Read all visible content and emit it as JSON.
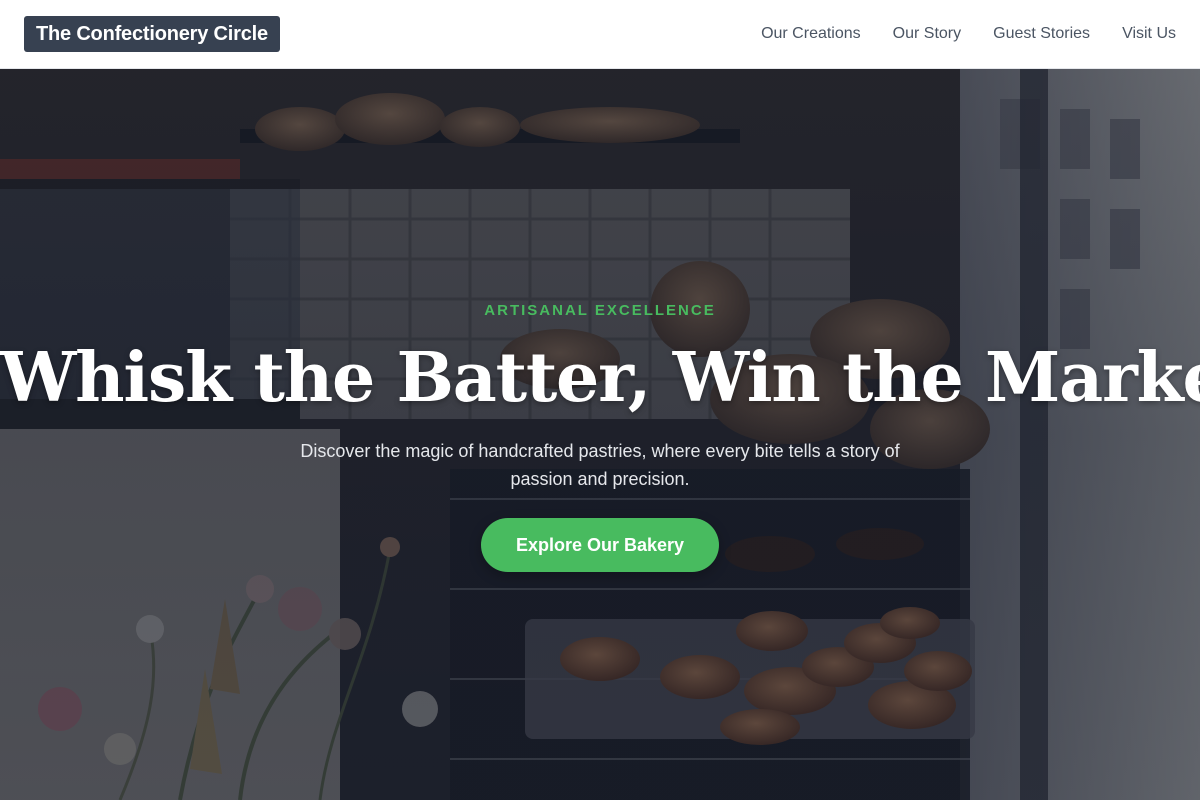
{
  "brand": {
    "name": "The Confectionery Circle"
  },
  "nav": {
    "items": [
      {
        "label": "Our Creations"
      },
      {
        "label": "Our Story"
      },
      {
        "label": "Guest Stories"
      },
      {
        "label": "Visit Us"
      }
    ]
  },
  "hero": {
    "eyebrow": "ARTISANAL EXCELLENCE",
    "headline": "Whisk the Batter, Win the Market.",
    "subheadline": "Discover the magic of handcrafted pastries, where every bite tells a story of passion and precision.",
    "cta_label": "Explore Our Bakery"
  },
  "colors": {
    "accent": "#48bb5f",
    "brand_bg": "#374151",
    "nav_text": "#4b5563",
    "overlay": "#111827"
  }
}
